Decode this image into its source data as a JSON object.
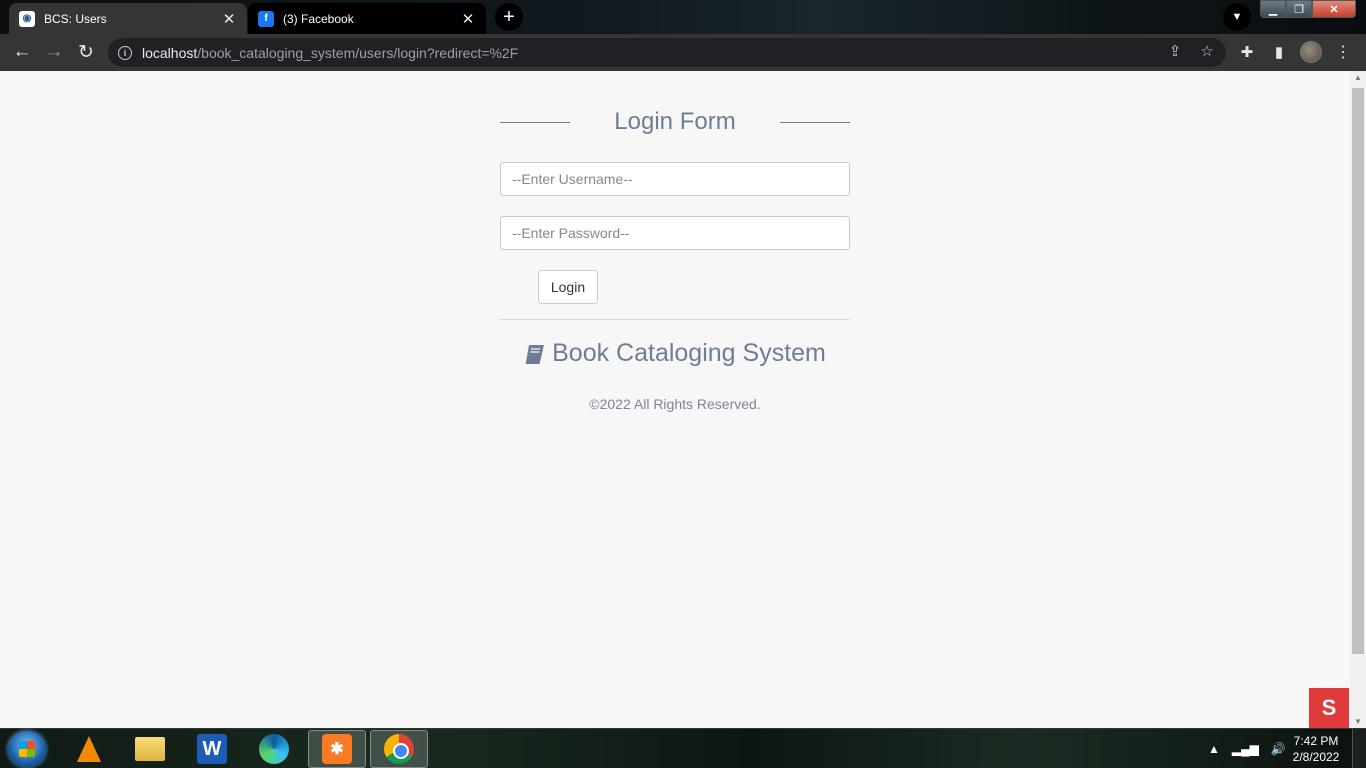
{
  "browser": {
    "tabs": [
      {
        "title": "BCS: Users",
        "active": true,
        "favicon": "bcs-favicon"
      },
      {
        "title": "(3) Facebook",
        "active": false,
        "favicon": "facebook-favicon"
      }
    ],
    "tab_close_glyph": "✕",
    "newtab_glyph": "+",
    "url_host": "localhost",
    "url_path": "/book_cataloging_system/users/login?redirect=%2F"
  },
  "login": {
    "heading": "Login Form",
    "username_placeholder": "--Enter Username--",
    "password_placeholder": "--Enter Password--",
    "login_button": "Login",
    "brand_name": "Book Cataloging System",
    "copyright": "©2022 All Rights Reserved."
  },
  "taskbar": {
    "apps": [
      "vlc",
      "file-explorer",
      "word",
      "edge",
      "xampp",
      "chrome"
    ],
    "time": "7:42 PM",
    "date": "2/8/2022"
  },
  "colors": {
    "accent_text": "#6e7d96",
    "page_bg": "#f7f7f7",
    "chrome_dark": "#353535"
  }
}
